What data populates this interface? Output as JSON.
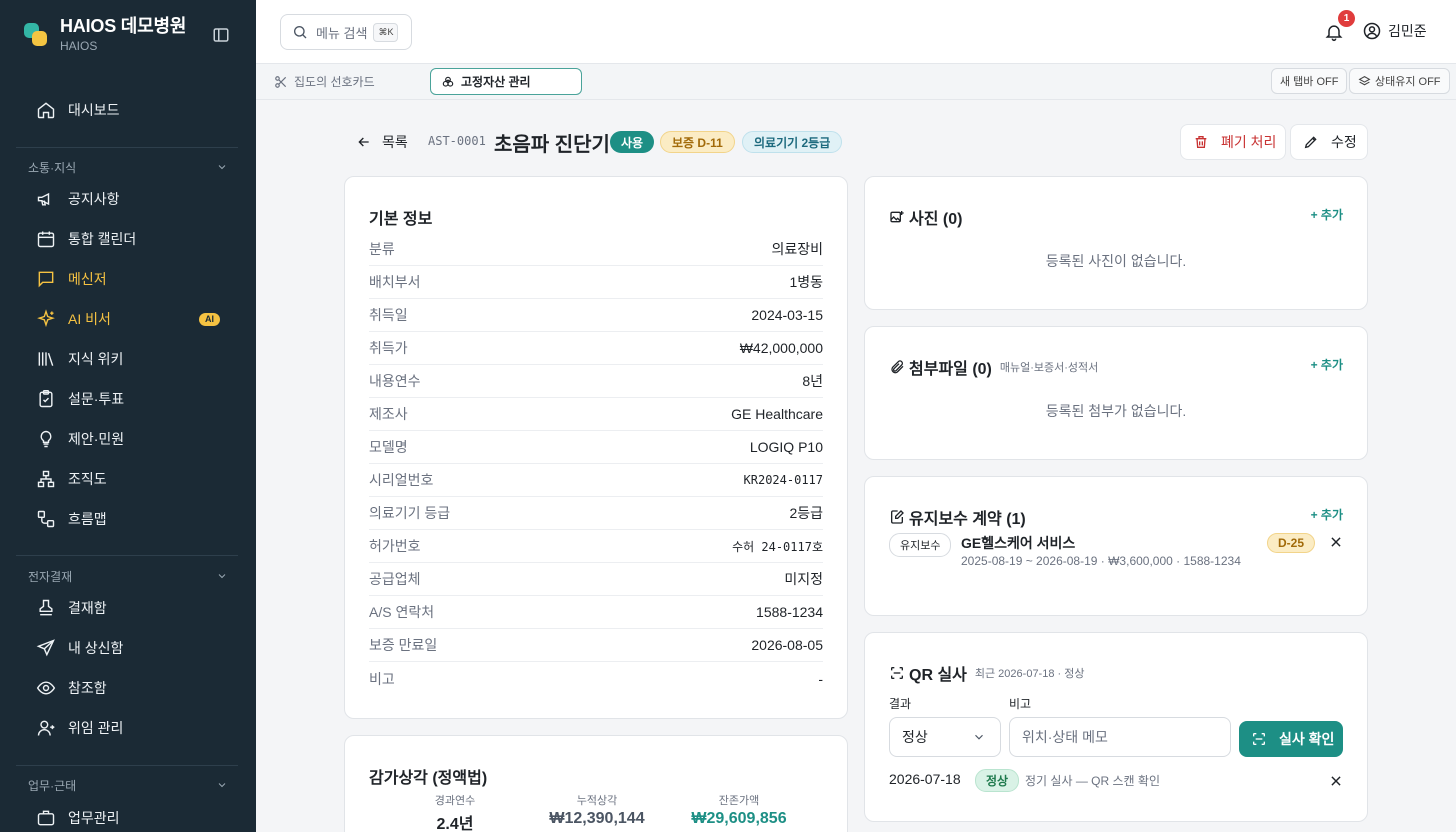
{
  "brand": {
    "title": "HAIOS 데모병원",
    "subtitle": "HAIOS"
  },
  "sidebar": {
    "top_items": [
      {
        "label": "대시보드",
        "icon": "home-icon"
      }
    ],
    "sections": [
      {
        "title": "소통·지식",
        "items": [
          {
            "label": "공지사항",
            "icon": "megaphone-icon"
          },
          {
            "label": "통합 캘린더",
            "icon": "calendar-icon"
          },
          {
            "label": "메신저",
            "icon": "message-icon",
            "active": true
          },
          {
            "label": "AI 비서",
            "icon": "sparkles-icon",
            "active": true,
            "badge": "AI"
          },
          {
            "label": "지식 위키",
            "icon": "library-icon"
          },
          {
            "label": "설문·투표",
            "icon": "clipboard-icon"
          },
          {
            "label": "제안·민원",
            "icon": "lightbulb-icon"
          },
          {
            "label": "조직도",
            "icon": "org-chart-icon"
          },
          {
            "label": "흐름맵",
            "icon": "workflow-icon"
          }
        ]
      },
      {
        "title": "전자결재",
        "items": [
          {
            "label": "결재함",
            "icon": "stamp-icon"
          },
          {
            "label": "내 상신함",
            "icon": "send-icon"
          },
          {
            "label": "참조함",
            "icon": "eye-icon"
          },
          {
            "label": "위임 관리",
            "icon": "user-delegate-icon"
          }
        ]
      },
      {
        "title": "업무·근태",
        "items": [
          {
            "label": "업무관리",
            "icon": "briefcase-icon"
          }
        ]
      }
    ]
  },
  "topbar": {
    "search_placeholder": "메뉴 검색",
    "search_shortcut": "⌘K",
    "notification_count": "1",
    "user_name": "김민준"
  },
  "tabs": [
    {
      "label": "집도의 선호카드",
      "icon": "scissors-icon",
      "active": false
    },
    {
      "label": "고정자산 관리",
      "icon": "biohazard-icon",
      "active": true
    }
  ],
  "tab_actions": {
    "new_tab": "새 탭바 OFF",
    "keep_state": "상태유지 OFF"
  },
  "asset": {
    "back_label": "목록",
    "code": "AST-0001",
    "name": "초음파 진단기",
    "status_badge": "사용",
    "warranty_badge": "보증 D-11",
    "class_badge": "의료기기 2등급",
    "dispose_label": "폐기 처리",
    "edit_label": "수정"
  },
  "basic_info": {
    "title": "기본 정보",
    "rows": [
      {
        "label": "분류",
        "value": "의료장비"
      },
      {
        "label": "배치부서",
        "value": "1병동"
      },
      {
        "label": "취득일",
        "value": "2024-03-15"
      },
      {
        "label": "취득가",
        "value": "₩42,000,000"
      },
      {
        "label": "내용연수",
        "value": "8년"
      },
      {
        "label": "제조사",
        "value": "GE Healthcare"
      },
      {
        "label": "모델명",
        "value": "LOGIQ P10"
      },
      {
        "label": "시리얼번호",
        "value": "KR2024-0117"
      },
      {
        "label": "의료기기 등급",
        "value": "2등급"
      },
      {
        "label": "허가번호",
        "value": "수허 24-0117호"
      },
      {
        "label": "공급업체",
        "value": "미지정"
      },
      {
        "label": "A/S 연락처",
        "value": "1588-1234"
      },
      {
        "label": "보증 만료일",
        "value": "2026-08-05"
      },
      {
        "label": "비고",
        "value": "-"
      }
    ]
  },
  "depreciation": {
    "title": "감가상각 (정액법)",
    "elapsed_label": "경과연수",
    "elapsed_value": "2.4년",
    "accum_label": "누적상각",
    "accum_value": "₩12,390,144",
    "remain_label": "잔존가액",
    "remain_value": "₩29,609,856"
  },
  "photos": {
    "title": "사진 (0)",
    "add": "+ 추가",
    "empty": "등록된 사진이 없습니다."
  },
  "attachments": {
    "title": "첨부파일 (0)",
    "subtitle": "매뉴얼·보증서·성적서",
    "add": "+ 추가",
    "empty": "등록된 첨부가 없습니다."
  },
  "maintenance": {
    "title": "유지보수 계약 (1)",
    "add": "+ 추가",
    "contract": {
      "tag": "유지보수",
      "name": "GE헬스케어 서비스",
      "detail": "2025-08-19 ~ 2026-08-19 · ₩3,600,000 · 1588-1234",
      "dday": "D-25"
    }
  },
  "qr_audit": {
    "title": "QR 실사",
    "subtitle": "최근 2026-07-18 · 정상",
    "result_label": "결과",
    "note_label": "비고",
    "result_value": "정상",
    "memo_placeholder": "위치·상태 메모",
    "confirm_label": "실사 확인",
    "history": {
      "date": "2026-07-18",
      "status": "정상",
      "note": "정기 실사 — QR 스캔 확인"
    }
  },
  "colors": {
    "sidebar_bg": "#1b2a35",
    "accent": "#1d8f85",
    "active_nav": "#f5c242",
    "danger": "#c83232"
  }
}
